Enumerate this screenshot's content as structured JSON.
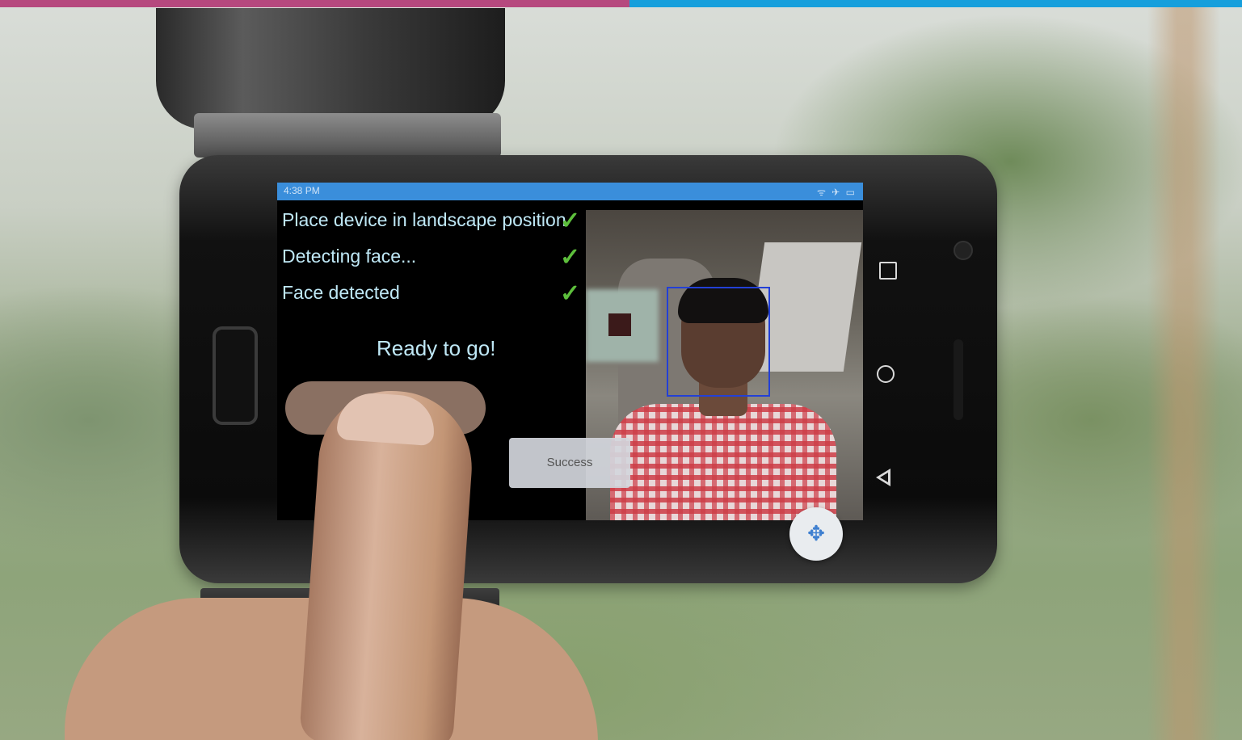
{
  "status_bar": {
    "time": "4:38 PM",
    "icons": "ᯤ ✈ ▭"
  },
  "checklist": [
    {
      "label": "Place device in landscape position",
      "status_icon": "check-icon"
    },
    {
      "label": "Detecting face...",
      "status_icon": "check-icon"
    },
    {
      "label": "Face detected",
      "status_icon": "check-icon"
    }
  ],
  "ready_text": "Ready to go!",
  "toast": {
    "text": "Success"
  },
  "fab": {
    "icon": "move-arrows-icon",
    "glyph": "✥"
  },
  "nav": {
    "recent_icon": "square-icon",
    "home_icon": "circle-icon",
    "back_icon": "triangle-back-icon"
  },
  "colors": {
    "top_bar_left": "#b6487e",
    "top_bar_right": "#169fdc",
    "status_bar": "#3a8edb",
    "check": "#5dbf3c",
    "text": "#bfe8f6",
    "face_box": "#2340d6"
  }
}
